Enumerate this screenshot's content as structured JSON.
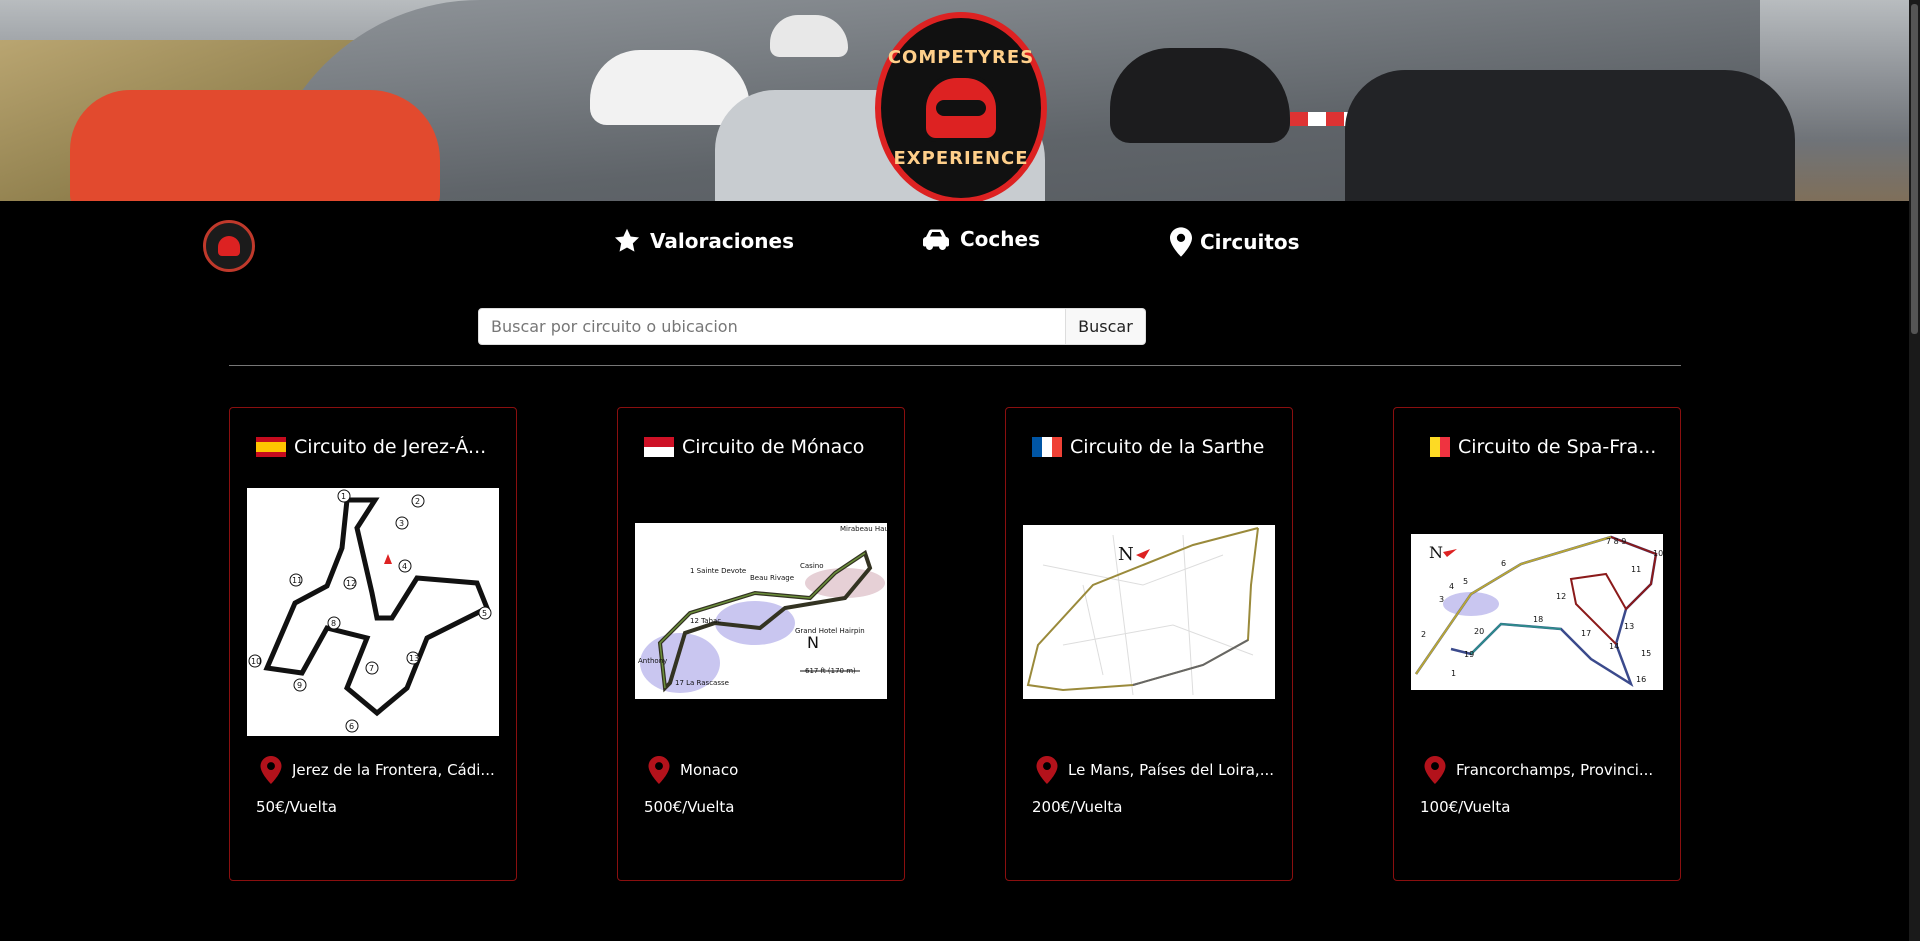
{
  "hero": {
    "logo_top_text": "COMPETYRES",
    "logo_bottom_text": "EXPERIENCE"
  },
  "nav": {
    "items": [
      {
        "label": "Valoraciones",
        "icon": "star-icon"
      },
      {
        "label": "Coches",
        "icon": "car-icon"
      },
      {
        "label": "Circuitos",
        "icon": "map-pin-icon"
      }
    ]
  },
  "search": {
    "placeholder": "Buscar por circuito o ubicacion",
    "value": "",
    "button_label": "Buscar"
  },
  "circuits": [
    {
      "name": "Circuito de Jerez-Á...",
      "flag": "spain",
      "location": "Jerez de la Frontera, Cádi...",
      "price": "50€/Vuelta"
    },
    {
      "name": "Circuito de Mónaco",
      "flag": "monaco",
      "location": "Monaco",
      "price": "500€/Vuelta"
    },
    {
      "name": "Circuito de la Sarthe",
      "flag": "france",
      "location": "Le Mans, Países del Loira,...",
      "price": "200€/Vuelta"
    },
    {
      "name": "Circuito de Spa-Fra...",
      "flag": "belgium",
      "location": "Francorchamps, Provinci...",
      "price": "100€/Vuelta"
    }
  ],
  "colors": {
    "accent_red": "#c0392b",
    "card_border": "#8a0f0f",
    "pin_red": "#b3121b"
  }
}
